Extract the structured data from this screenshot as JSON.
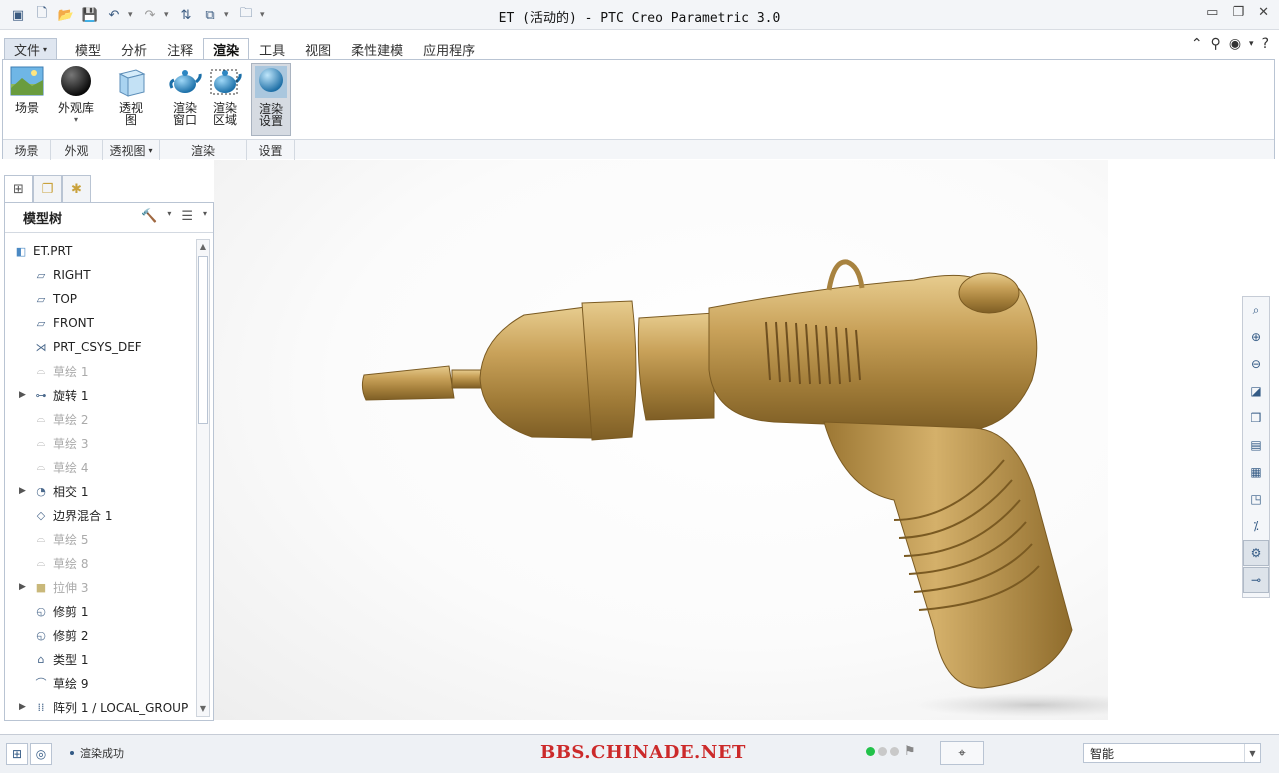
{
  "window": {
    "title": "ET (活动的) - PTC Creo Parametric 3.0"
  },
  "quick_access": {
    "icons": [
      "app-icon",
      "new-icon",
      "open-icon",
      "save-icon",
      "undo-icon",
      "redo-icon",
      "regenerate-icon",
      "windows-icon",
      "close-window-icon",
      "customize-icon"
    ]
  },
  "tabs": [
    {
      "label": "文件"
    },
    {
      "label": "模型"
    },
    {
      "label": "分析"
    },
    {
      "label": "注释"
    },
    {
      "label": "渲染"
    },
    {
      "label": "工具"
    },
    {
      "label": "视图"
    },
    {
      "label": "柔性建模"
    },
    {
      "label": "应用程序"
    }
  ],
  "ribbon": {
    "buttons": [
      {
        "label": "场景"
      },
      {
        "label": "外观库"
      },
      {
        "label": "透视图"
      },
      {
        "label": "渲染窗口"
      },
      {
        "label": "渲染区域"
      },
      {
        "label": "渲染设置"
      }
    ],
    "groups": [
      {
        "label": "场景"
      },
      {
        "label": "外观"
      },
      {
        "label": "透视图"
      },
      {
        "label": "渲染"
      },
      {
        "label": "设置"
      }
    ]
  },
  "model_tree": {
    "title": "模型树",
    "items": [
      {
        "label": "ET.PRT",
        "icon": "part-icon"
      },
      {
        "label": "RIGHT",
        "icon": "datum-plane-icon"
      },
      {
        "label": "TOP",
        "icon": "datum-plane-icon"
      },
      {
        "label": "FRONT",
        "icon": "datum-plane-icon"
      },
      {
        "label": "PRT_CSYS_DEF",
        "icon": "csys-icon"
      },
      {
        "label": "草绘 1",
        "icon": "sketch-icon"
      },
      {
        "label": "旋转 1",
        "icon": "revolve-icon"
      },
      {
        "label": "草绘 2",
        "icon": "sketch-icon"
      },
      {
        "label": "草绘 3",
        "icon": "sketch-icon"
      },
      {
        "label": "草绘 4",
        "icon": "sketch-icon"
      },
      {
        "label": "相交 1",
        "icon": "intersect-icon"
      },
      {
        "label": "边界混合 1",
        "icon": "boundary-blend-icon"
      },
      {
        "label": "草绘 5",
        "icon": "sketch-icon"
      },
      {
        "label": "草绘 8",
        "icon": "sketch-icon"
      },
      {
        "label": "拉伸 3",
        "icon": "extrude-icon"
      },
      {
        "label": "修剪 1",
        "icon": "trim-icon"
      },
      {
        "label": "修剪 2",
        "icon": "trim-icon"
      },
      {
        "label": "类型 1",
        "icon": "style-icon"
      },
      {
        "label": "草绘 9",
        "icon": "sketch-icon"
      },
      {
        "label": "阵列 1 / LOCAL_GROUP",
        "icon": "pattern-icon"
      }
    ]
  },
  "status": {
    "message": "渲染成功",
    "watermark": "BBS.CHINADE.NET",
    "filter": "智能"
  }
}
